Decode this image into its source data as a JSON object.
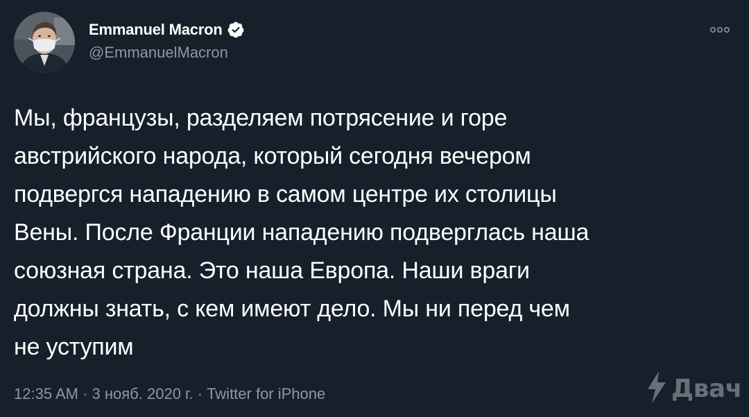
{
  "author": {
    "display_name": "Emmanuel Macron",
    "handle": "@EmmanuelMacron",
    "verified": true
  },
  "tweet": {
    "text": "Мы, французы, разделяем потрясение и горе\nавстрийского народа, который сегодня вечером\nподвергся нападению в самом центре их столицы\nВены. После Франции нападению подверглась наша\nсоюзная страна. Это наша Европа. Наши враги\nдолжны знать, с кем имеют дело. Мы ни перед чем\nне уступим"
  },
  "meta": {
    "time": "12:35 AM",
    "separator": " · ",
    "date": "3 нояб. 2020 г.",
    "source": "Twitter for iPhone"
  },
  "watermark": {
    "text": "Двач",
    "icon": "lightning-icon"
  },
  "icons": {
    "verified": "verified-badge-icon",
    "more": "more-options-icon"
  },
  "colors": {
    "background": "#15202b",
    "text_primary": "#ffffff",
    "text_secondary": "#8b98a5",
    "verified_badge": "#ffffff"
  }
}
